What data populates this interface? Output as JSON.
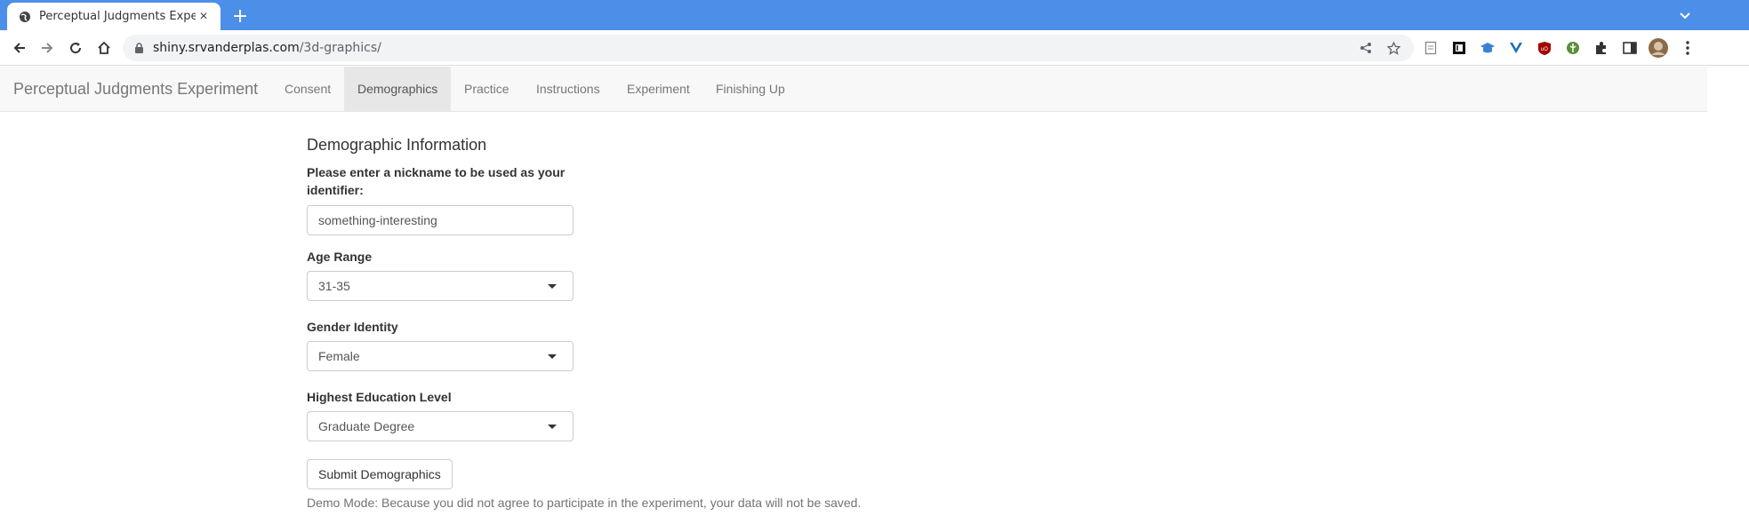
{
  "browser": {
    "tab_title": "Perceptual Judgments Experi",
    "url_host": "shiny.srvanderplas.com",
    "url_path": "/3d-graphics/"
  },
  "navbar": {
    "brand": "Perceptual Judgments Experiment",
    "items": [
      {
        "label": "Consent"
      },
      {
        "label": "Demographics"
      },
      {
        "label": "Practice"
      },
      {
        "label": "Instructions"
      },
      {
        "label": "Experiment"
      },
      {
        "label": "Finishing Up"
      }
    ],
    "active": "Demographics"
  },
  "form": {
    "title": "Demographic Information",
    "nickname_label": "Please enter a nickname to be used as your identifier:",
    "nickname_value": "something-interesting",
    "age_label": "Age Range",
    "age_value": "31-35",
    "gender_label": "Gender Identity",
    "gender_value": "Female",
    "education_label": "Highest Education Level",
    "education_value": "Graduate Degree",
    "submit_label": "Submit Demographics",
    "demo_note": "Demo Mode: Because you did not agree to participate in the experiment, your data will not be saved."
  },
  "colors": {
    "tabstrip": "#4b8fe8",
    "navbar_bg": "#f8f8f8",
    "navbar_active": "#e7e7e7"
  }
}
